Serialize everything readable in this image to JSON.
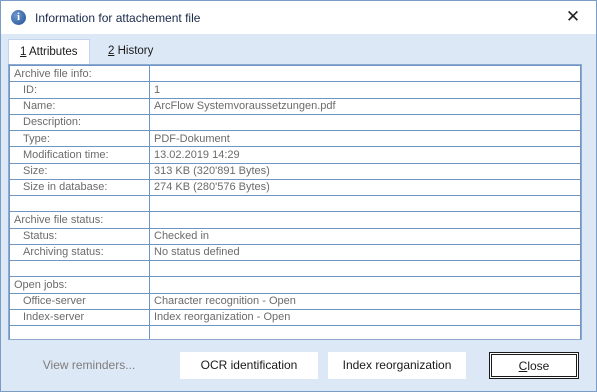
{
  "window": {
    "title": "Information for attachement file",
    "icon": "info-icon",
    "close_glyph": "✕"
  },
  "tabs": [
    {
      "mnemonic": "1",
      "label": " Attributes",
      "active": true
    },
    {
      "mnemonic": "2",
      "label": " History",
      "active": false
    }
  ],
  "rows": [
    {
      "label": "Archive file info:",
      "value": "",
      "section": true
    },
    {
      "label": "ID:",
      "value": "1",
      "section": false
    },
    {
      "label": "Name:",
      "value": "ArcFlow Systemvoraussetzungen.pdf",
      "section": false
    },
    {
      "label": "Description:",
      "value": "",
      "section": false
    },
    {
      "label": "Type:",
      "value": "PDF-Dokument",
      "section": false
    },
    {
      "label": "Modification time:",
      "value": "13.02.2019  14:29",
      "section": false
    },
    {
      "label": "Size:",
      "value": "313 KB  (320'891 Bytes)",
      "section": false
    },
    {
      "label": "Size in database:",
      "value": "274 KB  (280'576 Bytes)",
      "section": false
    },
    {
      "label": "",
      "value": "",
      "section": true
    },
    {
      "label": "Archive file status:",
      "value": "",
      "section": true
    },
    {
      "label": "Status:",
      "value": "Checked in",
      "section": false
    },
    {
      "label": "Archiving status:",
      "value": "No status defined",
      "section": false
    },
    {
      "label": "",
      "value": "",
      "section": true
    },
    {
      "label": "Open jobs:",
      "value": "",
      "section": true
    },
    {
      "label": "Office-server",
      "value": "Character recognition - Open",
      "section": false
    },
    {
      "label": "Index-server",
      "value": "Index reorganization - Open",
      "section": false
    },
    {
      "label": "",
      "value": "",
      "section": true
    }
  ],
  "buttons": {
    "view_reminders": "View reminders...",
    "ocr": "OCR identification",
    "index_reorg": "Index reorganization",
    "close_mnemonic": "C",
    "close_rest": "lose"
  }
}
